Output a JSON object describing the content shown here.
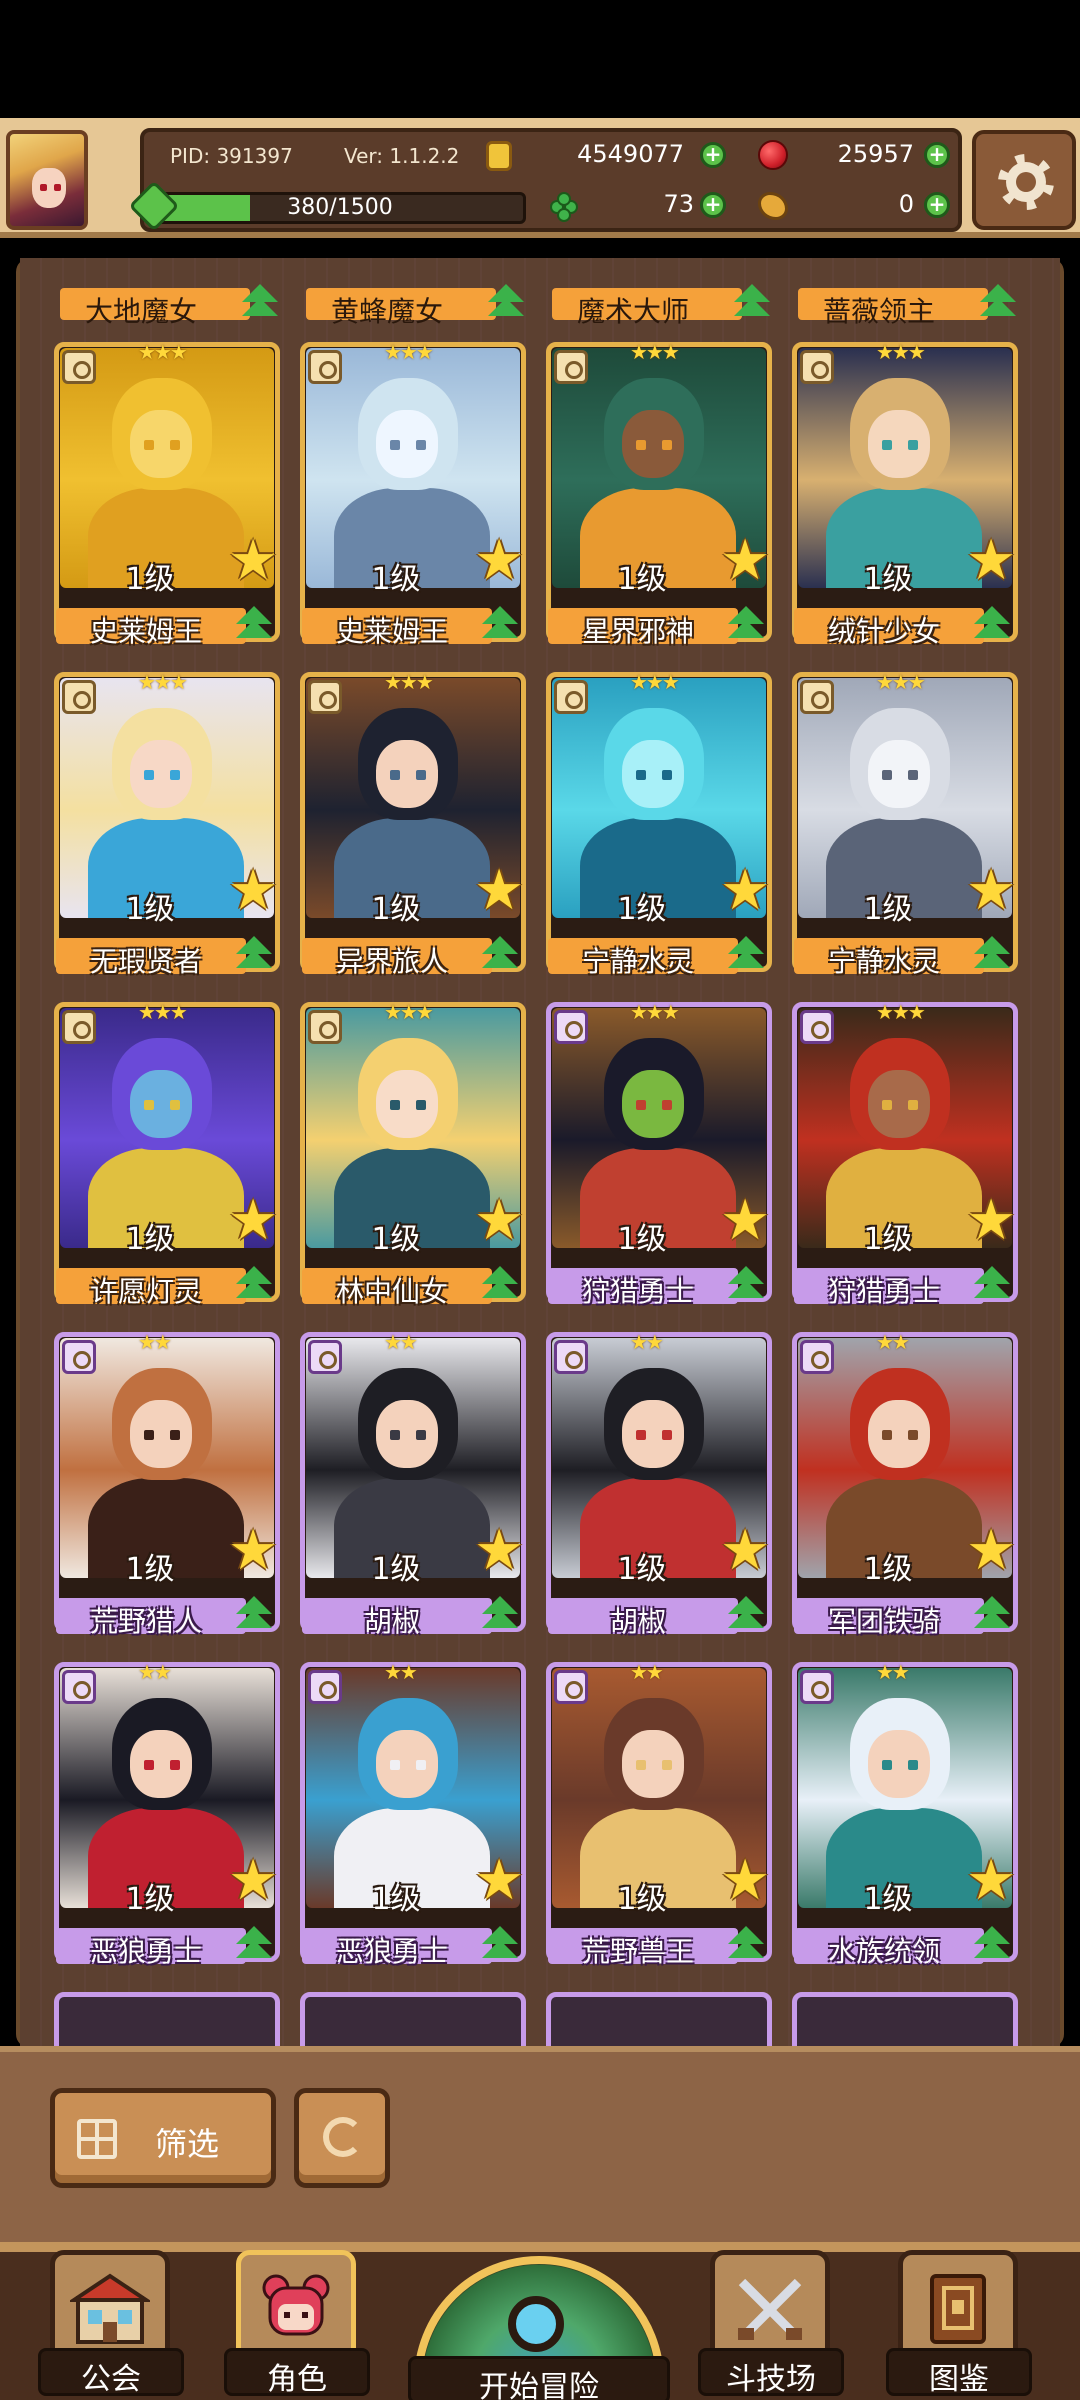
{
  "header": {
    "pid": "PID: 391397",
    "version": "Ver: 1.1.2.2",
    "gold": "4549077",
    "gems": "25957",
    "exp_text": "380/1500",
    "exp_fraction": 0.2533,
    "clovers": "73",
    "food": "0"
  },
  "top_row": [
    "大地魔女",
    "黄蜂魔女",
    "魔术大师",
    "蔷薇领主"
  ],
  "cards": [
    {
      "name": "史莱姆王",
      "level": "1级",
      "rarity": "gold",
      "stars": "★★★",
      "palette": [
        "#f0c030",
        "#d49a14",
        "#f7d66a",
        "#e0a020"
      ]
    },
    {
      "name": "史莱姆王",
      "level": "1级",
      "rarity": "gold",
      "stars": "★★★",
      "palette": [
        "#cfe4f0",
        "#9ab8d8",
        "#eef6ff",
        "#6a86a8"
      ]
    },
    {
      "name": "星界邪神",
      "level": "1级",
      "rarity": "gold",
      "stars": "★★★",
      "palette": [
        "#2e6e5a",
        "#1e4a3a",
        "#8a5a3a",
        "#e89a30"
      ]
    },
    {
      "name": "绒针少女",
      "level": "1级",
      "rarity": "gold",
      "stars": "★★★",
      "palette": [
        "#d8b070",
        "#2a3050",
        "#f5d7bd",
        "#3aa0a0"
      ]
    },
    {
      "name": "无瑕贤者",
      "level": "1级",
      "rarity": "gold",
      "stars": "★★★",
      "palette": [
        "#f4e0a0",
        "#e8e4f0",
        "#f7d8c6",
        "#3aa6d8"
      ]
    },
    {
      "name": "异界旅人",
      "level": "1级",
      "rarity": "gold",
      "stars": "★★★",
      "palette": [
        "#1e2230",
        "#7a4a2a",
        "#f4d2bc",
        "#4a6a8a"
      ]
    },
    {
      "name": "宁静水灵",
      "level": "1级",
      "rarity": "gold",
      "stars": "★★★",
      "palette": [
        "#5ad8e8",
        "#2aa0c0",
        "#a8f0f8",
        "#1a6a8a"
      ]
    },
    {
      "name": "宁静水灵",
      "level": "1级",
      "rarity": "gold",
      "stars": "★★★",
      "palette": [
        "#d8dce4",
        "#a0a8b8",
        "#f2f4f8",
        "#5a6478"
      ]
    },
    {
      "name": "许愿灯灵",
      "level": "1级",
      "rarity": "gold",
      "stars": "★★★",
      "palette": [
        "#6a4ad8",
        "#3a2a8a",
        "#6ab0e0",
        "#e0c040"
      ]
    },
    {
      "name": "林中仙女",
      "level": "1级",
      "rarity": "gold",
      "stars": "★★★",
      "palette": [
        "#f4d070",
        "#4a9aa0",
        "#f8dcc8",
        "#2a5a6a"
      ]
    },
    {
      "name": "狩猎勇士",
      "level": "1级",
      "rarity": "purple",
      "stars": "★★★",
      "palette": [
        "#1a1a2a",
        "#8a5a2a",
        "#7ab840",
        "#c04030"
      ]
    },
    {
      "name": "狩猎勇士",
      "level": "1级",
      "rarity": "purple",
      "stars": "★★★",
      "palette": [
        "#c03020",
        "#3a2a1a",
        "#a86a4a",
        "#e0b040"
      ]
    },
    {
      "name": "荒野猎人",
      "level": "1级",
      "rarity": "purple",
      "stars": "★★",
      "palette": [
        "#c07040",
        "#f0e8e0",
        "#f4d2bc",
        "#3a2018"
      ]
    },
    {
      "name": "胡椒",
      "level": "1级",
      "rarity": "purple",
      "stars": "★★",
      "palette": [
        "#1e1e24",
        "#e8e8ec",
        "#f4d2bc",
        "#3a3a44"
      ]
    },
    {
      "name": "胡椒",
      "level": "1级",
      "rarity": "purple",
      "stars": "★★",
      "palette": [
        "#1e1e24",
        "#c8ccd4",
        "#f4d2bc",
        "#c03030"
      ]
    },
    {
      "name": "军团铁骑",
      "level": "1级",
      "rarity": "purple",
      "stars": "★★",
      "palette": [
        "#c03020",
        "#a0a4ac",
        "#f4d2bc",
        "#7a4a2a"
      ]
    },
    {
      "name": "恶狼勇士",
      "level": "1级",
      "rarity": "purple",
      "stars": "★★",
      "palette": [
        "#1a1a24",
        "#e8e0d8",
        "#f4d2bc",
        "#c02030"
      ]
    },
    {
      "name": "恶狼勇士",
      "level": "1级",
      "rarity": "purple",
      "stars": "★★",
      "palette": [
        "#3aa0d0",
        "#6a3a2a",
        "#f4d2bc",
        "#f0f0f4"
      ]
    },
    {
      "name": "荒野兽王",
      "level": "1级",
      "rarity": "purple",
      "stars": "★★",
      "palette": [
        "#6a3a2a",
        "#a85a30",
        "#f4d2bc",
        "#e8c070"
      ]
    },
    {
      "name": "水族统领",
      "level": "1级",
      "rarity": "purple",
      "stars": "★★",
      "palette": [
        "#e8f0f8",
        "#3a7a6a",
        "#f4d2bc",
        "#2a8a8a"
      ]
    }
  ],
  "controls": {
    "filter_label": "筛选"
  },
  "nav": {
    "guild": "公会",
    "character": "角色",
    "adventure": "开始冒险",
    "arena": "斗技场",
    "codex": "图鉴"
  }
}
